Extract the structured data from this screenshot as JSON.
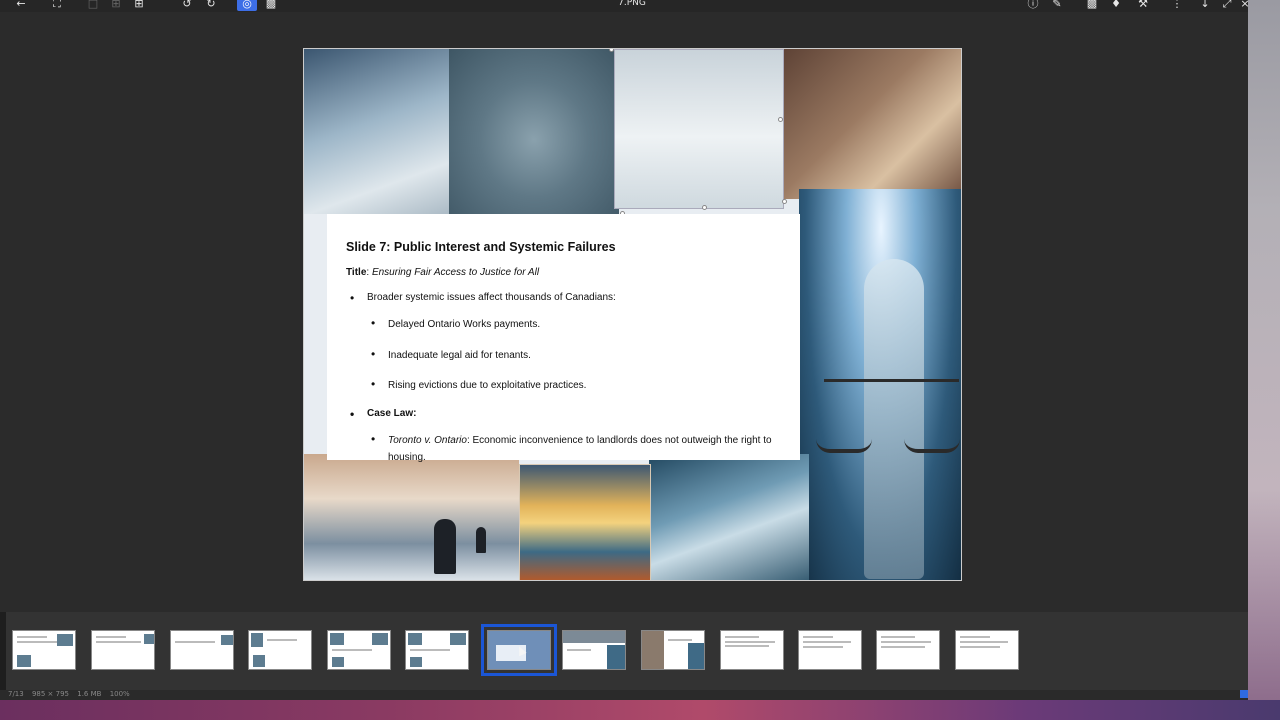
{
  "window": {
    "title": "7.PNG"
  },
  "toolbar": {
    "left_icons": [
      "back-arrow-icon",
      "fullscreen-icon",
      "page-single-icon",
      "page-grid-icon",
      "add-icon",
      "rotate-left-icon",
      "rotate-right-icon",
      "view-icon",
      "layers-icon"
    ],
    "right_icons": [
      "info-icon",
      "edit-pen-icon",
      "comment-icon",
      "tag-icon",
      "tools-icon",
      "more-icon",
      "download-icon",
      "expand-icon",
      "close-icon"
    ]
  },
  "slide": {
    "heading": "Slide 7: Public Interest and Systemic Failures",
    "title_label": "Title",
    "title_value": "Ensuring Fair Access to Justice for All",
    "bullets": {
      "b1": "Broader systemic issues affect thousands of Canadians:",
      "b1_sub": [
        "Delayed Ontario Works payments.",
        "Inadequate legal aid for tenants.",
        "Rising evictions due to exploitative practices."
      ],
      "b2": "Case Law:",
      "b2_case": "Toronto v. Ontario",
      "b2_text": ": Economic inconvenience to landlords does not outweigh the right to housing."
    }
  },
  "thumbnails": {
    "count": 13,
    "selected_index": 6
  },
  "status": {
    "position": "7/13",
    "dimensions": "985 × 795",
    "size": "1.6 MB",
    "zoom": "100%"
  },
  "colors": {
    "accent": "#1b56d6",
    "background": "#2b2b2b"
  }
}
